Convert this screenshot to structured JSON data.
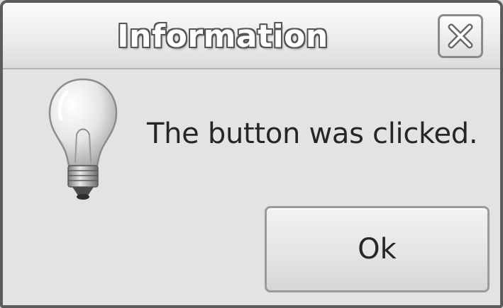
{
  "window": {
    "title": "Information",
    "close_icon": "close-icon"
  },
  "dialog": {
    "icon": "lightbulb-icon",
    "message": "The button was clicked.",
    "ok_label": "Ok"
  }
}
